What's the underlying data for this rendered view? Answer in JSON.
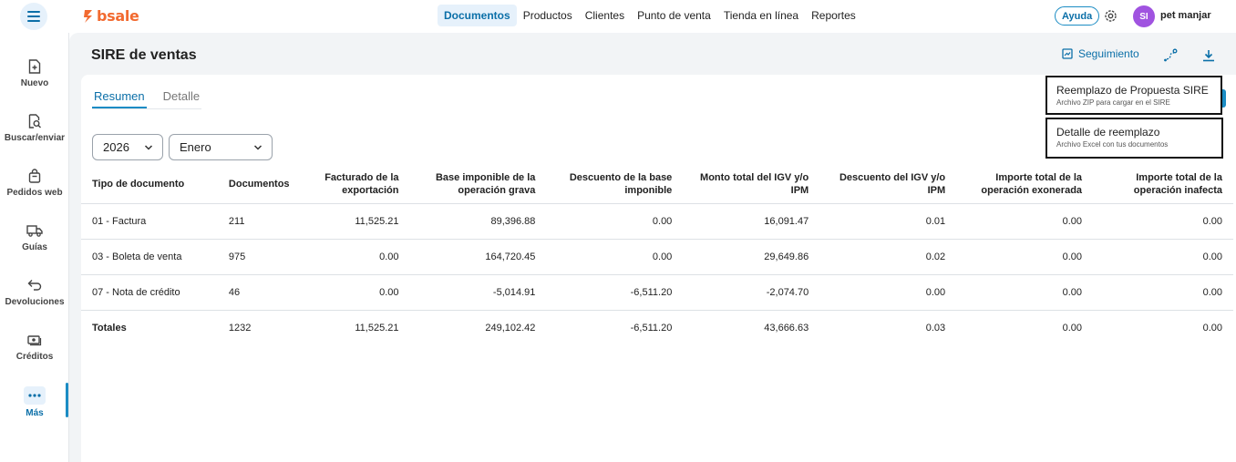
{
  "app": {
    "brand": "bsale",
    "brand_color": "#f26a30",
    "accent": "#1b8cc4"
  },
  "header": {
    "nav": [
      "Documentos",
      "Productos",
      "Clientes",
      "Punto de venta",
      "Tienda en línea",
      "Reportes"
    ],
    "active_nav": "Documentos",
    "help_label": "Ayuda",
    "avatar_initials": "SI",
    "user_name": "pet manjar"
  },
  "sidebar": {
    "items": [
      {
        "label": "Nuevo",
        "icon": "new-document-icon"
      },
      {
        "label": "Buscar/enviar",
        "icon": "search-document-icon"
      },
      {
        "label": "Pedidos web",
        "icon": "bag-icon"
      },
      {
        "label": "Guías",
        "icon": "truck-icon"
      },
      {
        "label": "Devoluciones",
        "icon": "return-arrow-icon"
      },
      {
        "label": "Créditos",
        "icon": "credit-icon"
      },
      {
        "label": "Más",
        "icon": "more-dots-icon"
      }
    ],
    "active": "Más"
  },
  "page": {
    "title": "SIRE de ventas",
    "follow_label": "Seguimiento",
    "tabs": [
      "Resumen",
      "Detalle"
    ],
    "active_tab": "Resumen",
    "year": "2026",
    "month": "Enero"
  },
  "table": {
    "headers": [
      "Tipo de documento",
      "Documentos",
      "Facturado de la exportación",
      "Base imponible de la operación grava",
      "Descuento de la base imponible",
      "Monto total del IGV y/o IPM",
      "Descuento del IGV y/o IPM",
      "Importe total de la operación exonerada",
      "Importe total de la operación inafecta"
    ],
    "rows": [
      [
        "01 - Factura",
        "211",
        "11,525.21",
        "89,396.88",
        "0.00",
        "16,091.47",
        "0.01",
        "0.00",
        "0.00"
      ],
      [
        "03 - Boleta de venta",
        "975",
        "0.00",
        "164,720.45",
        "0.00",
        "29,649.86",
        "0.02",
        "0.00",
        "0.00"
      ],
      [
        "07 - Nota de crédito",
        "46",
        "0.00",
        "-5,014.91",
        "-6,511.20",
        "-2,074.70",
        "0.00",
        "0.00",
        "0.00"
      ]
    ],
    "totals": [
      "Totales",
      "1232",
      "11,525.21",
      "249,102.42",
      "-6,511.20",
      "43,666.63",
      "0.03",
      "0.00",
      "0.00"
    ]
  },
  "download_menu": [
    {
      "title": "Reemplazo de Propuesta SIRE",
      "subtitle": "Archivo ZIP para cargar en el SIRE"
    },
    {
      "title": "Detalle de reemplazo",
      "subtitle": "Archivo Excel con tus documentos"
    }
  ]
}
